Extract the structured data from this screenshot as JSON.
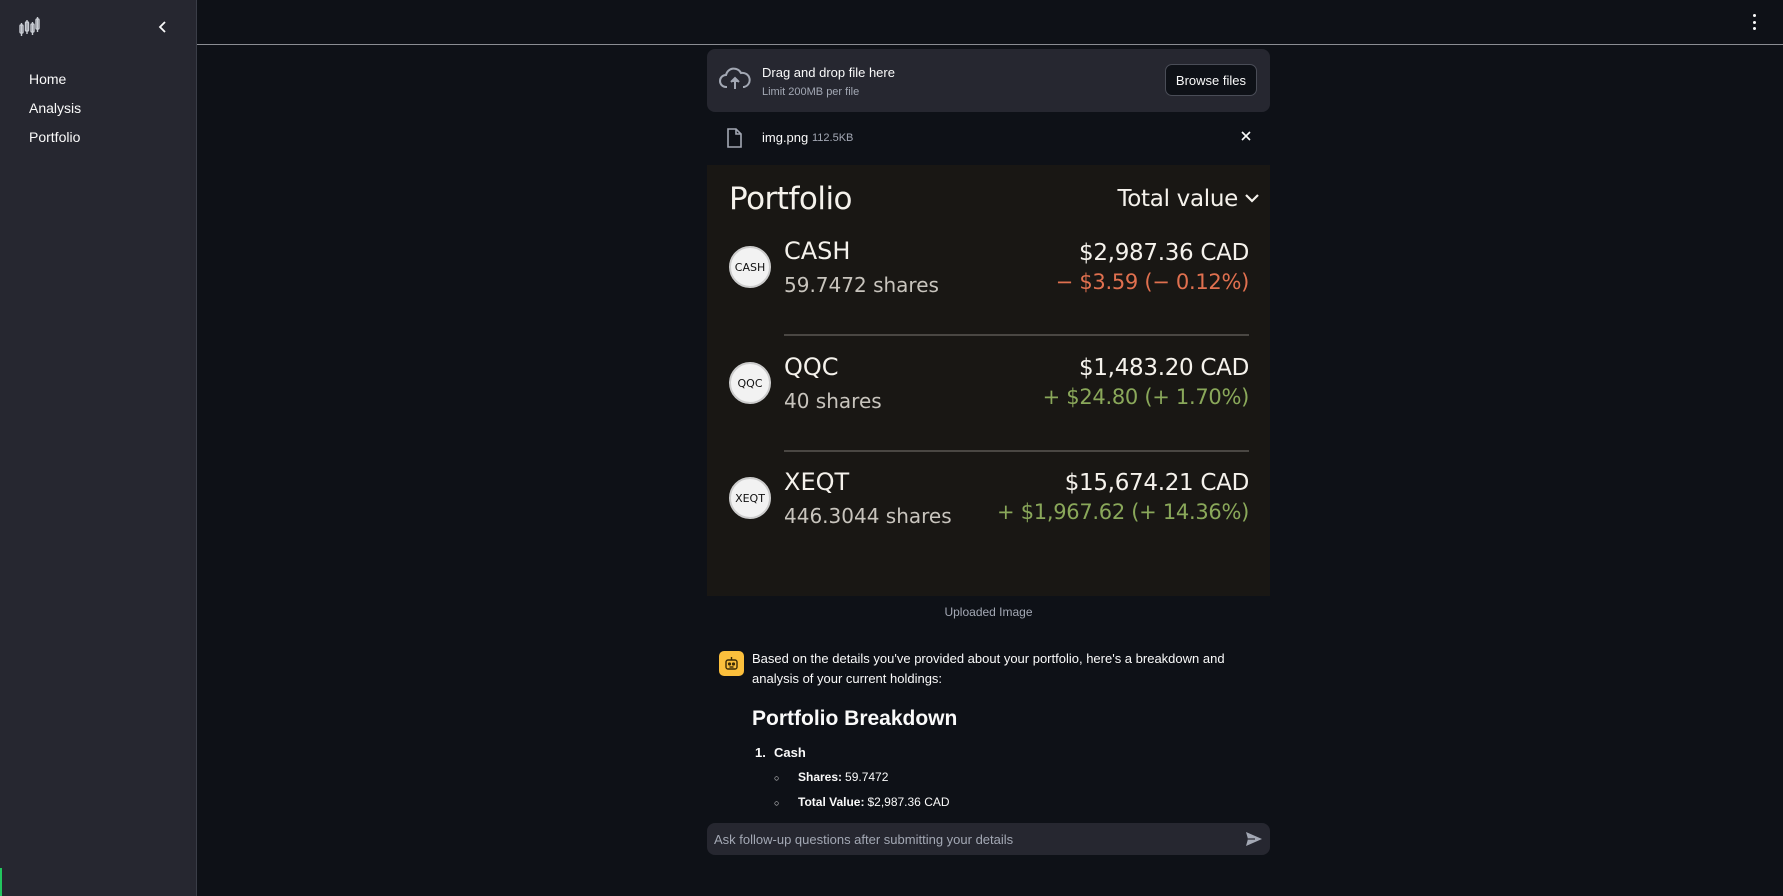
{
  "sidebar": {
    "items": [
      {
        "label": "Home"
      },
      {
        "label": "Analysis"
      },
      {
        "label": "Portfolio"
      }
    ]
  },
  "uploader": {
    "title": "Drag and drop file here",
    "limit": "Limit 200MB per file",
    "browse_label": "Browse files"
  },
  "file": {
    "name": "img.png",
    "size": "112.5KB"
  },
  "portfolio_image": {
    "title": "Portfolio",
    "sort_label": "Total value",
    "holdings": [
      {
        "symbol": "CASH",
        "badge": "CASH",
        "shares": "59.7472 shares",
        "value": "$2,987.36 CAD",
        "change": "− $3.59 (− 0.12%)",
        "direction": "negative"
      },
      {
        "symbol": "QQC",
        "badge": "QQC",
        "shares": "40 shares",
        "value": "$1,483.20 CAD",
        "change": "+ $24.80 (+ 1.70%)",
        "direction": "positive"
      },
      {
        "symbol": "XEQT",
        "badge": "XEQT",
        "shares": "446.3044 shares",
        "value": "$15,674.21 CAD",
        "change": "+ $1,967.62 (+ 14.36%)",
        "direction": "positive"
      }
    ]
  },
  "caption": "Uploaded Image",
  "chat": {
    "intro": "Based on the details you've provided about your portfolio, here's a breakdown and analysis of your current holdings:",
    "heading": "Portfolio Breakdown",
    "list": [
      {
        "num": "1.",
        "title": "Cash",
        "details": [
          {
            "label": "Shares:",
            "value": "59.7472"
          },
          {
            "label": "Total Value:",
            "value": "$2,987.36 CAD"
          }
        ]
      }
    ]
  },
  "chat_input": {
    "placeholder": "Ask follow-up questions after submitting your details"
  },
  "colors": {
    "background": "#0e1117",
    "sidebar": "#262730",
    "negative": "#e0704f",
    "positive": "#8aa85a",
    "bot_avatar": "#fbbf3c"
  }
}
